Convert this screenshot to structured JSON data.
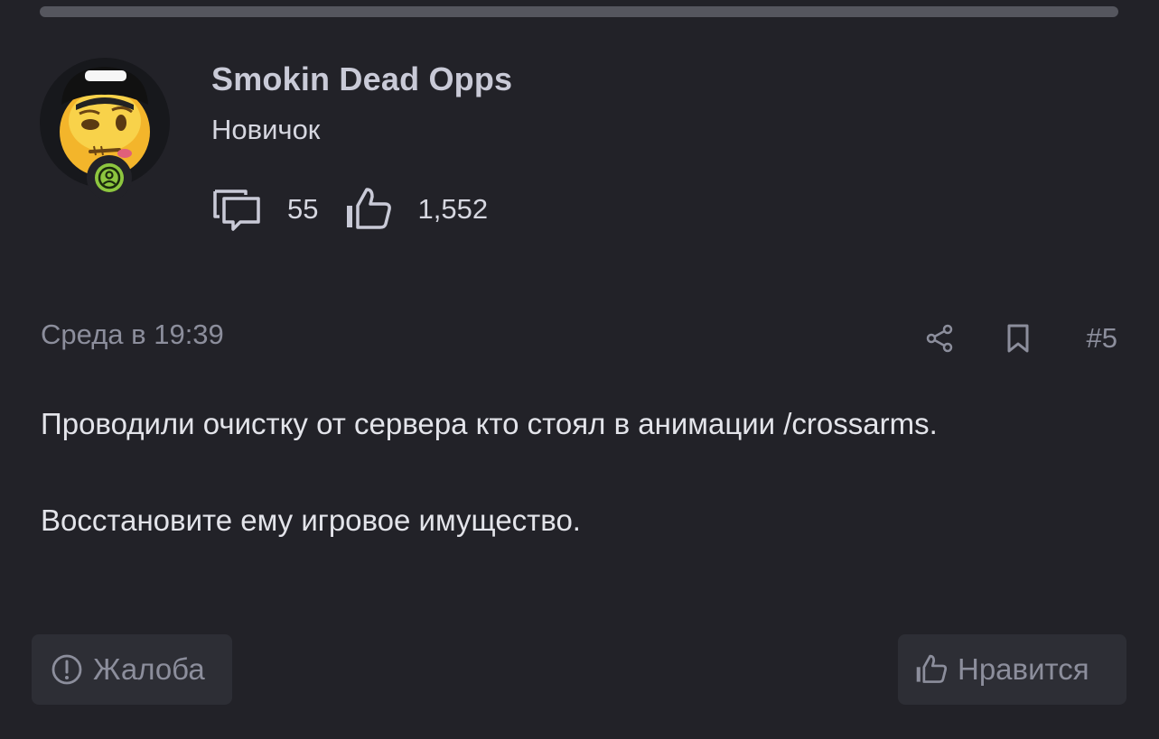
{
  "user": {
    "name": "Smokin Dead Opps",
    "title": "Новичок",
    "message_count": "55",
    "reaction_score": "1,552",
    "avatar_icon": "emoji-avatar",
    "status_icon": "user-status-icon"
  },
  "post": {
    "date": "Среда в 19:39",
    "number": "#5",
    "paragraphs": [
      "Проводили очистку от сервера кто стоял в анимации /crossarms.",
      "Восстановите ему игровое имущество."
    ]
  },
  "actions": {
    "report_label": "Жалоба",
    "like_label": "Нравится"
  },
  "colors": {
    "background": "#222228",
    "button_bg": "#2d2e35",
    "muted_text": "#8c8e9c",
    "status_green": "#8dc63f"
  }
}
